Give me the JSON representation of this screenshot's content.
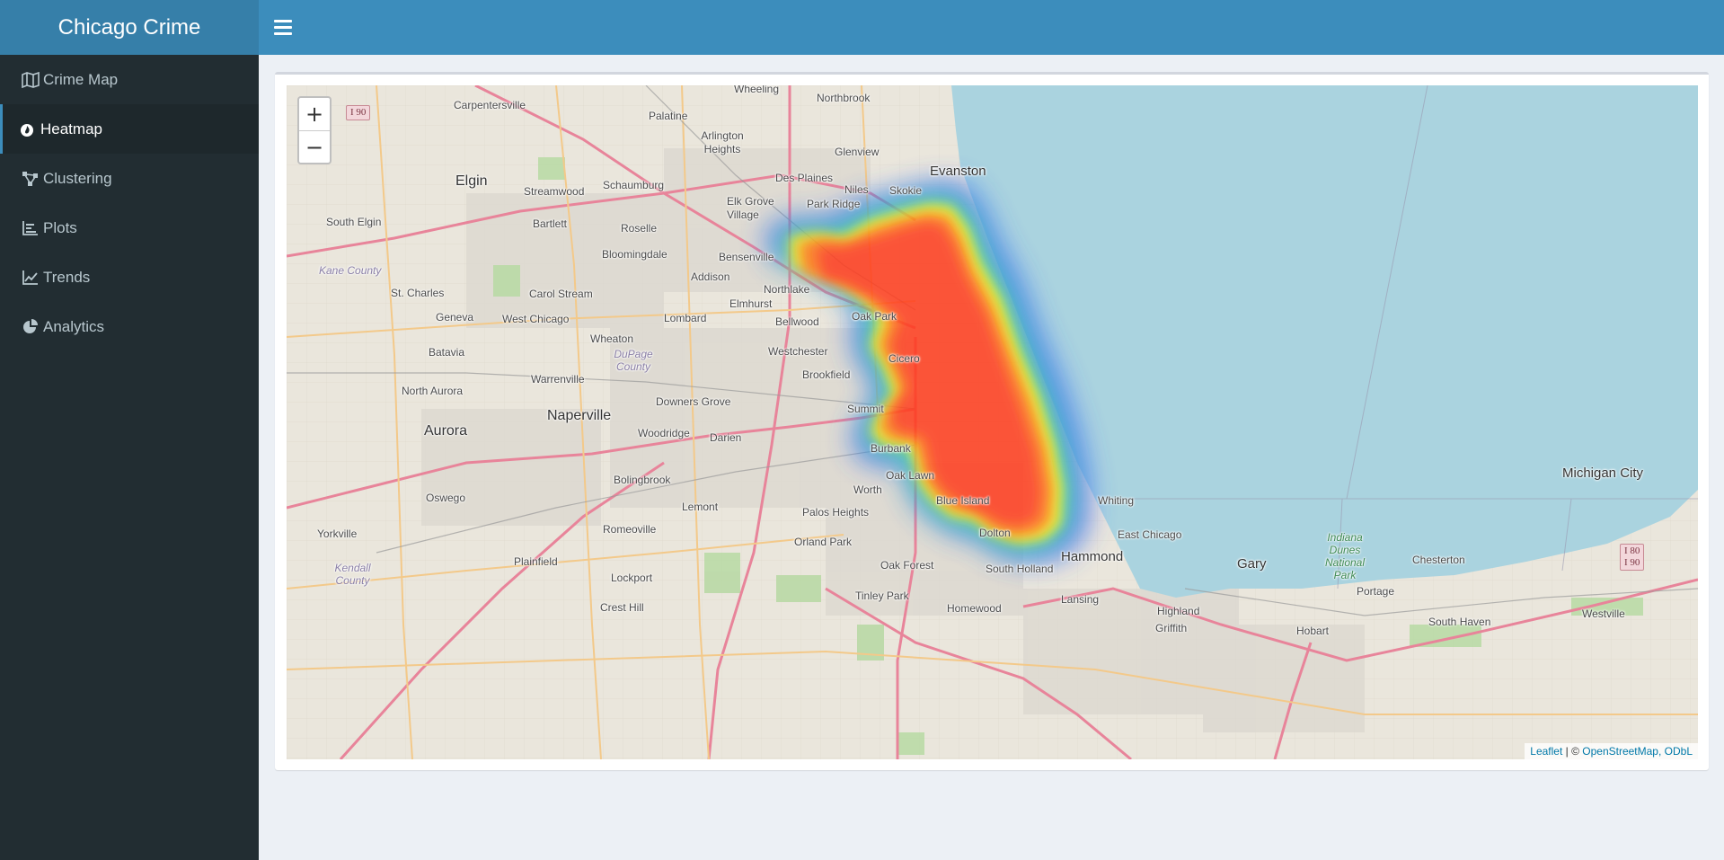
{
  "app": {
    "title": "Chicago Crime"
  },
  "sidebar": {
    "items": [
      {
        "label": "Crime Map",
        "icon": "map-icon",
        "active": false
      },
      {
        "label": "Heatmap",
        "icon": "fire-icon",
        "active": true
      },
      {
        "label": "Clustering",
        "icon": "clustering-icon",
        "active": false
      },
      {
        "label": "Plots",
        "icon": "bar-chart-icon",
        "active": false
      },
      {
        "label": "Trends",
        "icon": "line-chart-icon",
        "active": false
      },
      {
        "label": "Analytics",
        "icon": "pie-chart-icon",
        "active": false
      }
    ]
  },
  "map": {
    "zoom_in": "+",
    "zoom_out": "−",
    "attribution": {
      "leaflet": "Leaflet",
      "separator": " | © ",
      "osm": "OpenStreetMap, ODbL"
    },
    "places": [
      "Wheeling",
      "Northbrook",
      "Carpentersville",
      "Palatine",
      "Arlington Heights",
      "Glenview",
      "Des Plaines",
      "Evanston",
      "Niles",
      "Skokie",
      "Elgin",
      "Streamwood",
      "Schaumburg",
      "Elk Grove Village",
      "Park Ridge",
      "South Elgin",
      "Bartlett",
      "Roselle",
      "Bloomingdale",
      "Bensenville",
      "Kane County",
      "Addison",
      "Northlake",
      "St. Charles",
      "Carol Stream",
      "Elmhurst",
      "Oak Park",
      "Geneva",
      "West Chicago",
      "Lombard",
      "Bellwood",
      "Wheaton",
      "Batavia",
      "DuPage County",
      "Westchester",
      "Cicero",
      "Brookfield",
      "North Aurora",
      "Warrenville",
      "Downers Grove",
      "Summit",
      "Naperville",
      "Aurora",
      "Woodridge",
      "Darien",
      "Burbank",
      "Oak Lawn",
      "Bolingbrook",
      "Oswego",
      "Lemont",
      "Worth",
      "Palos Heights",
      "Blue Island",
      "Whiting",
      "Dolton",
      "East Chicago",
      "Michigan City",
      "Yorkville",
      "Romeoville",
      "Orland Park",
      "Hammond",
      "Kendall County",
      "Plainfield",
      "Lockport",
      "Oak Forest",
      "South Holland",
      "Gary",
      "Indiana Dunes National Park",
      "Chesterton",
      "Portage",
      "Tinley Park",
      "Lansing",
      "Highland",
      "Crest Hill",
      "Homewood",
      "Griffith",
      "Hobart",
      "South Haven",
      "Westville"
    ],
    "shields": [
      "I 90",
      "I 80\nI 90"
    ],
    "colors": {
      "land": "#eae6dc",
      "water": "#aad3df",
      "park": "#b7d9a3",
      "highway": "#e8849a",
      "major_road": "#f3c98a"
    }
  }
}
